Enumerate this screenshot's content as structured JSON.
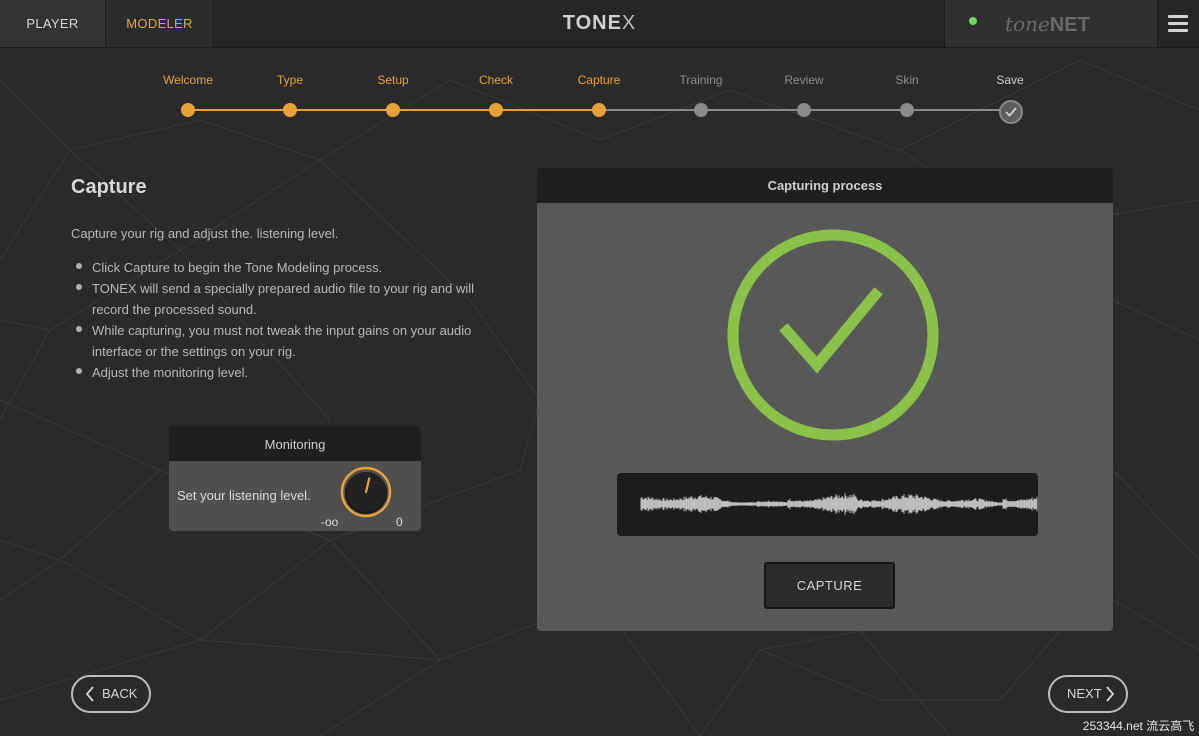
{
  "topbar": {
    "tabs": [
      {
        "label": "PLAYER",
        "active": false
      },
      {
        "label": "MODELER",
        "active": true
      }
    ],
    "logo_main": "TONE",
    "logo_x": "X",
    "tonenet_script": "tone",
    "tonenet_bold": "NET",
    "status_color": "#6ddc5c"
  },
  "steps": [
    {
      "label": "Welcome",
      "state": "done"
    },
    {
      "label": "Type",
      "state": "done"
    },
    {
      "label": "Setup",
      "state": "done"
    },
    {
      "label": "Check",
      "state": "done"
    },
    {
      "label": "Capture",
      "state": "done"
    },
    {
      "label": "Training",
      "state": "todo"
    },
    {
      "label": "Review",
      "state": "todo"
    },
    {
      "label": "Skin",
      "state": "todo"
    },
    {
      "label": "Save",
      "state": "final"
    }
  ],
  "content": {
    "title": "Capture",
    "intro": "Capture your rig and adjust the. listening level.",
    "bullets": [
      "Click Capture to begin the Tone Modeling process.",
      "TONEX will send a specially prepared audio file to your rig and will record the processed sound.",
      "While capturing, you must not tweak the input gains on your audio interface or the settings on your rig.",
      "Adjust the monitoring level."
    ]
  },
  "monitoring": {
    "title": "Monitoring",
    "label": "Set your listening level.",
    "min_label": "-oo",
    "max_label": "0",
    "knob_level": 0.55
  },
  "capture": {
    "title": "Capturing process",
    "status": "complete",
    "button_label": "CAPTURE",
    "check_color": "#8bc34a"
  },
  "nav": {
    "back_label": "BACK",
    "next_label": "NEXT"
  },
  "watermark": "253344.net 流云高飞",
  "colors": {
    "accent": "#e8a23a",
    "inactive": "#8a8a8a",
    "background": "#2a2a2a"
  }
}
